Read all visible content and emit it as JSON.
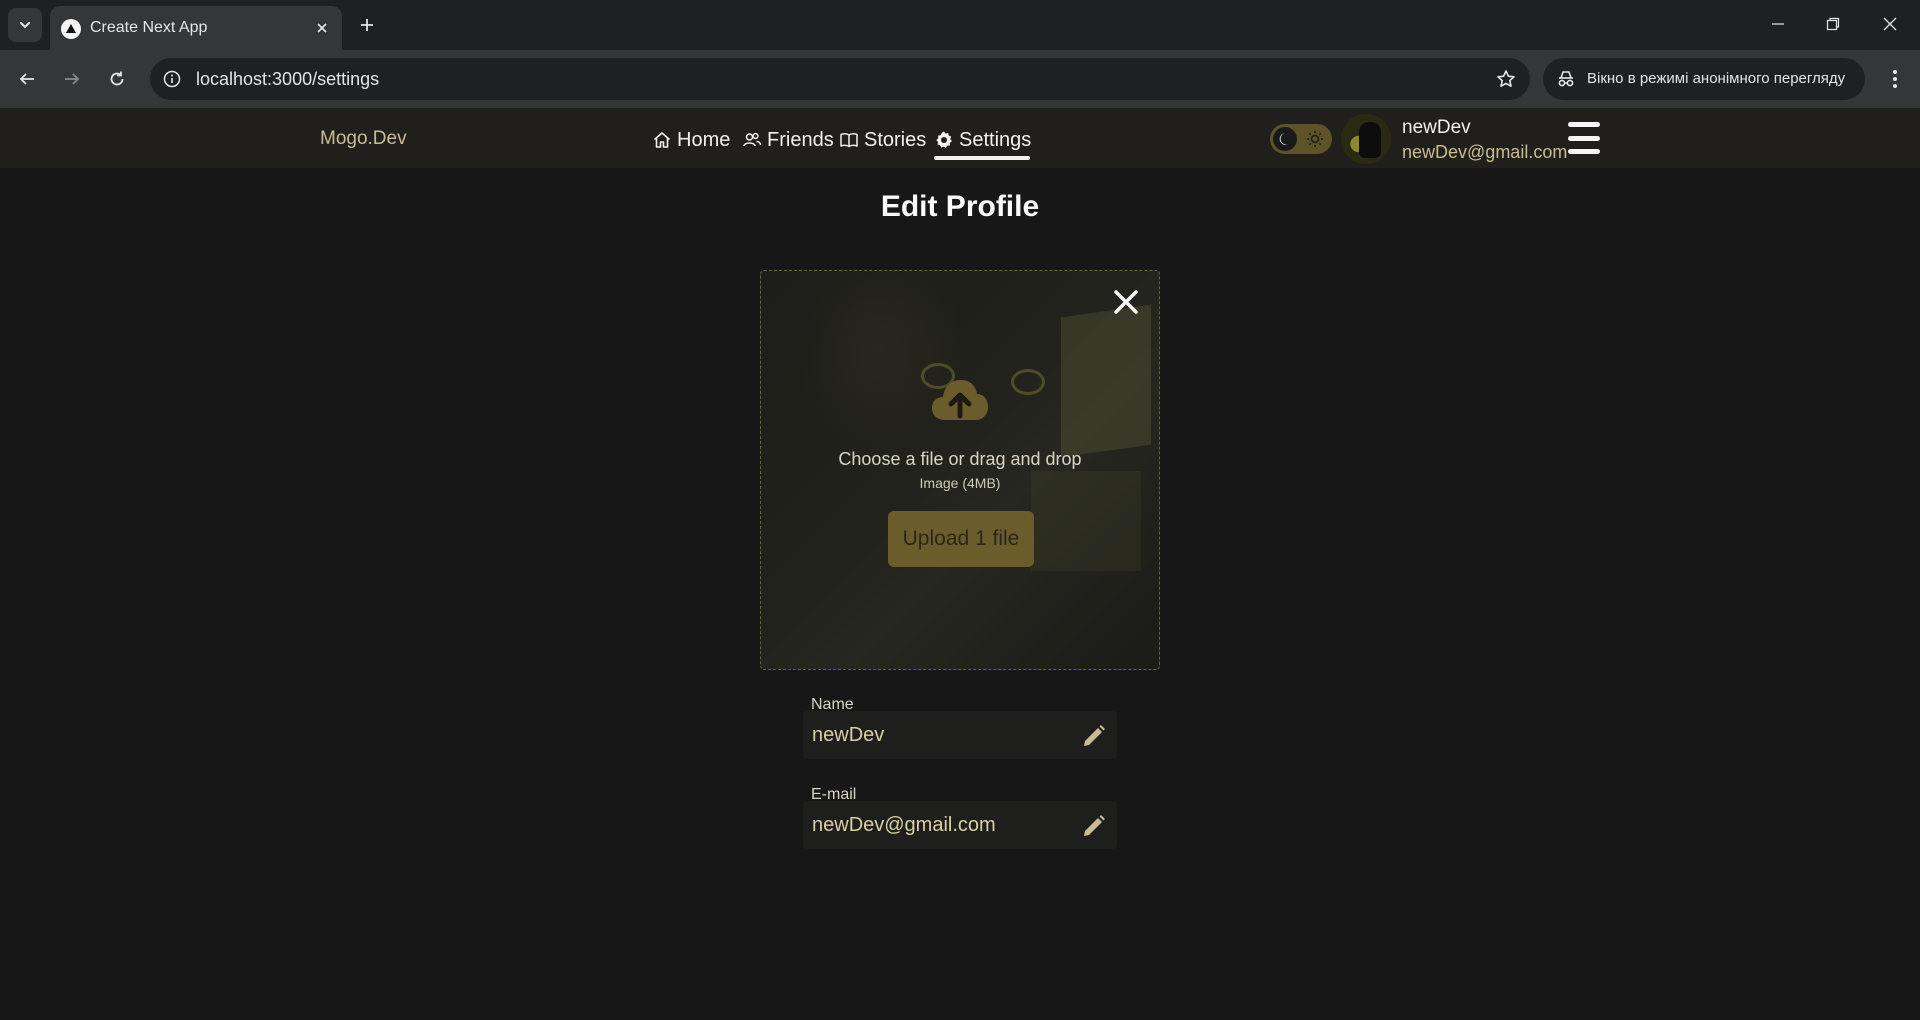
{
  "browser": {
    "tab_title": "Create Next App",
    "url": "localhost:3000/settings",
    "incognito_label": "Вікно в режимі анонімного перегляду"
  },
  "header": {
    "logo": "Mogo.Dev",
    "nav": [
      {
        "label": "Home",
        "icon": "home-icon"
      },
      {
        "label": "Friends",
        "icon": "users-icon"
      },
      {
        "label": "Stories",
        "icon": "book-icon"
      },
      {
        "label": "Settings",
        "icon": "gear-icon",
        "active": true
      }
    ],
    "user": {
      "name": "newDev",
      "email": "newDev@gmail.com"
    },
    "theme": "dark"
  },
  "main": {
    "title": "Edit Profile",
    "upload": {
      "prompt": "Choose a file or drag and drop",
      "hint": "Image (4MB)",
      "button": "Upload 1 file"
    },
    "fields": [
      {
        "label": "Name",
        "value": "newDev"
      },
      {
        "label": "E-mail",
        "value": "newDev@gmail.com"
      }
    ]
  },
  "colors": {
    "accent": "#c9bc93",
    "button": "#6b5d2b",
    "background": "#171717",
    "header": "#211f1b"
  }
}
